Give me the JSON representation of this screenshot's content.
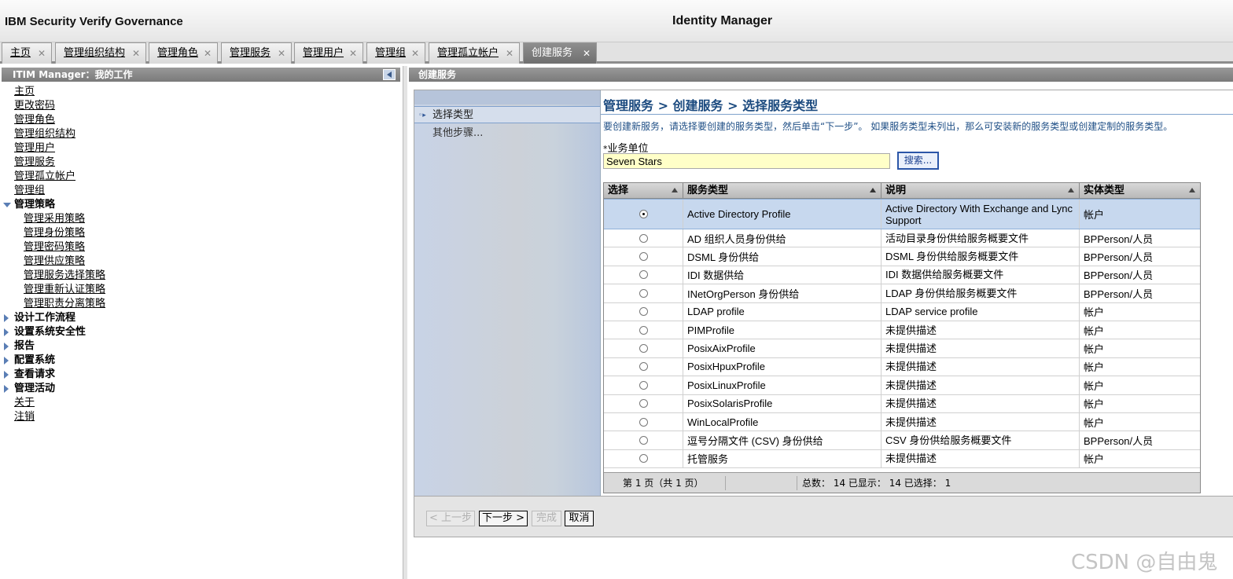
{
  "header": {
    "brand": "IBM Security Verify Governance",
    "app_title": "Identity Manager"
  },
  "tabs": [
    {
      "label": "主页",
      "close": "✕"
    },
    {
      "label": "管理组织结构",
      "close": "✕"
    },
    {
      "label": "管理角色",
      "close": "✕"
    },
    {
      "label": "管理服务",
      "close": "✕"
    },
    {
      "label": "管理用户",
      "close": "✕"
    },
    {
      "label": "管理组",
      "close": "✕"
    },
    {
      "label": "管理孤立帐户",
      "close": "✕"
    },
    {
      "label": "创建服务",
      "close": "✕"
    }
  ],
  "left_panel": {
    "title": "ITIM Manager：我的工作",
    "items": [
      {
        "label": "主页"
      },
      {
        "label": "更改密码"
      },
      {
        "label": "管理角色"
      },
      {
        "label": "管理组织结构"
      },
      {
        "label": "管理用户"
      },
      {
        "label": "管理服务"
      },
      {
        "label": "管理孤立帐户"
      },
      {
        "label": "管理组"
      },
      {
        "label": "管理策略"
      },
      {
        "label": "管理采用策略"
      },
      {
        "label": "管理身份策略"
      },
      {
        "label": "管理密码策略"
      },
      {
        "label": "管理供应策略"
      },
      {
        "label": "管理服务选择策略"
      },
      {
        "label": "管理重新认证策略"
      },
      {
        "label": "管理职责分离策略"
      },
      {
        "label": "设计工作流程"
      },
      {
        "label": "设置系统安全性"
      },
      {
        "label": "报告"
      },
      {
        "label": "配置系统"
      },
      {
        "label": "查看请求"
      },
      {
        "label": "管理活动"
      },
      {
        "label": "关于"
      },
      {
        "label": "注销"
      }
    ]
  },
  "right_panel": {
    "title": "创建服务"
  },
  "wizard": {
    "steps": {
      "current": "选择类型",
      "other": "其他步骤..."
    },
    "title": "管理服务 > 创建服务 > 选择服务类型",
    "description": "要创建新服务，请选择要创建的服务类型，然后单击“下一步”。 如果服务类型未列出，那么可安装新的服务类型或创建定制的服务类型。",
    "business_unit_required": "*",
    "business_unit_label": "业务单位",
    "business_unit_value": "Seven Stars",
    "search_label": "搜索..."
  },
  "table": {
    "columns": [
      "选择",
      "服务类型",
      "说明",
      "实体类型"
    ],
    "rows": [
      {
        "type": "Active Directory Profile",
        "desc": "Active Directory With Exchange and Lync Support",
        "entity": "帐户",
        "selected": true
      },
      {
        "type": "AD 组织人员身份供给",
        "desc": "活动目录身份供给服务概要文件",
        "entity": "BPPerson/人员",
        "selected": false
      },
      {
        "type": "DSML 身份供给",
        "desc": "DSML 身份供给服务概要文件",
        "entity": "BPPerson/人员",
        "selected": false
      },
      {
        "type": "IDI 数据供给",
        "desc": "IDI 数据供给服务概要文件",
        "entity": "BPPerson/人员",
        "selected": false
      },
      {
        "type": "INetOrgPerson 身份供给",
        "desc": "LDAP 身份供给服务概要文件",
        "entity": "BPPerson/人员",
        "selected": false
      },
      {
        "type": "LDAP profile",
        "desc": "LDAP service profile",
        "entity": "帐户",
        "selected": false
      },
      {
        "type": "PIMProfile",
        "desc": "未提供描述",
        "entity": "帐户",
        "selected": false
      },
      {
        "type": "PosixAixProfile",
        "desc": "未提供描述",
        "entity": "帐户",
        "selected": false
      },
      {
        "type": "PosixHpuxProfile",
        "desc": "未提供描述",
        "entity": "帐户",
        "selected": false
      },
      {
        "type": "PosixLinuxProfile",
        "desc": "未提供描述",
        "entity": "帐户",
        "selected": false
      },
      {
        "type": "PosixSolarisProfile",
        "desc": "未提供描述",
        "entity": "帐户",
        "selected": false
      },
      {
        "type": "WinLocalProfile",
        "desc": "未提供描述",
        "entity": "帐户",
        "selected": false
      },
      {
        "type": "逗号分隔文件 (CSV) 身份供给",
        "desc": "CSV 身份供给服务概要文件",
        "entity": "BPPerson/人员",
        "selected": false
      },
      {
        "type": "托管服务",
        "desc": "未提供描述",
        "entity": "帐户",
        "selected": false
      }
    ],
    "footer": {
      "page_info": "第 1 页（共 1 页）",
      "totals": "总数： 14  已显示： 14  已选择： 1"
    }
  },
  "buttons": {
    "back": "< 上一步",
    "next": "下一步 >",
    "finish": "完成",
    "cancel": "取消"
  },
  "watermark": "CSDN @自由鬼"
}
